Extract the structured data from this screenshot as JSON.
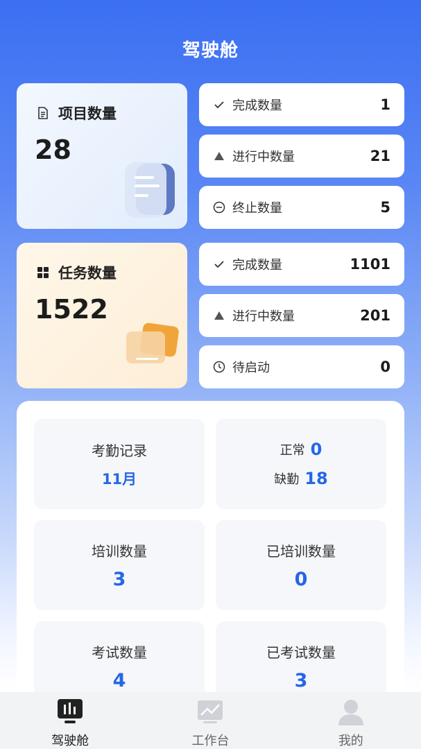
{
  "header": {
    "title": "驾驶舱"
  },
  "project": {
    "label": "项目数量",
    "value": "28",
    "stats": [
      {
        "icon": "check-icon",
        "label": "完成数量",
        "value": "1"
      },
      {
        "icon": "triangle-icon",
        "label": "进行中数量",
        "value": "21"
      },
      {
        "icon": "minus-circle-icon",
        "label": "终止数量",
        "value": "5"
      }
    ]
  },
  "task": {
    "label": "任务数量",
    "value": "1522",
    "stats": [
      {
        "icon": "check-icon",
        "label": "完成数量",
        "value": "1101"
      },
      {
        "icon": "triangle-icon",
        "label": "进行中数量",
        "value": "201"
      },
      {
        "icon": "clock-icon",
        "label": "待启动",
        "value": "0"
      }
    ]
  },
  "panel": {
    "attendance": {
      "label": "考勤记录",
      "month": "11月"
    },
    "attendance_status": {
      "normal_label": "正常",
      "normal_value": "0",
      "absent_label": "缺勤",
      "absent_value": "18"
    },
    "training": {
      "label": "培训数量",
      "value": "3"
    },
    "trained": {
      "label": "已培训数量",
      "value": "0"
    },
    "exam": {
      "label": "考试数量",
      "value": "4"
    },
    "examined": {
      "label": "已考试数量",
      "value": "3"
    }
  },
  "tabbar": {
    "items": [
      {
        "label": "驾驶舱",
        "icon": "dashboard-icon",
        "active": true
      },
      {
        "label": "工作台",
        "icon": "chart-icon",
        "active": false
      },
      {
        "label": "我的",
        "icon": "user-icon",
        "active": false
      }
    ]
  },
  "colors": {
    "accent": "#2566e8",
    "header_bg": "#3b6ff2"
  }
}
